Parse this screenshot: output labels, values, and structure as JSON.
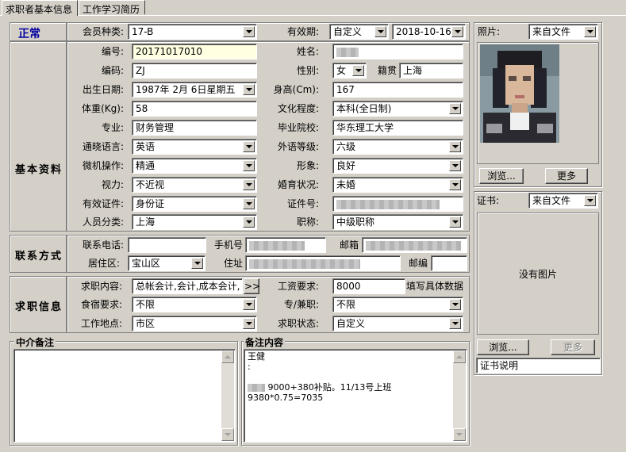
{
  "tabs": [
    {
      "label": "求职者基本信息"
    },
    {
      "label": "工作学习简历"
    }
  ],
  "status": {
    "text": "正常",
    "color": "#0000a0"
  },
  "top": {
    "member_type_label": "会员种类:",
    "member_type": "17-B",
    "validity_label": "有效期:",
    "validity_type": "自定义",
    "validity_date": "2018-10-16"
  },
  "basic": {
    "group_label": "基本资料",
    "number_label": "编号:",
    "number": "20171017010",
    "name_label": "姓名:",
    "code_label": "编码:",
    "code": "ZJ",
    "gender_label": "性别:",
    "gender": "女",
    "native_label": "籍贯",
    "native": "上海",
    "birth_label": "出生日期:",
    "birth": "1987年 2月 6日星期五",
    "height_label": "身高(Cm):",
    "height": "167",
    "weight_label": "体重(Kg):",
    "weight": "58",
    "edu_label": "文化程度:",
    "edu": "本科(全日制)",
    "major_label": "专业:",
    "major": "财务管理",
    "school_label": "毕业院校:",
    "school": "华东理工大学",
    "lang_label": "通晓语言:",
    "lang": "英语",
    "lang_level_label": "外语等级:",
    "lang_level": "六级",
    "pc_label": "微机操作:",
    "pc": "精通",
    "image_label": "形象:",
    "image": "良好",
    "vision_label": "视力:",
    "vision": "不近视",
    "marital_label": "婚育状况:",
    "marital": "未婚",
    "id_type_label": "有效证件:",
    "id_type": "身份证",
    "id_no_label": "证件号:",
    "category_label": "人员分类:",
    "category": "上海",
    "title_label": "职称:",
    "title": "中级职称"
  },
  "contact": {
    "group_label": "联系方式",
    "phone_label": "联系电话:",
    "mobile_label": "手机号",
    "email_label": "邮箱",
    "district_label": "居住区:",
    "district": "宝山区",
    "address_label": "住址",
    "postcode_label": "邮编"
  },
  "job": {
    "group_label": "求职信息",
    "position_label": "求职内容:",
    "position": "总帐会计,会计,成本会计,",
    "more_btn": ">>",
    "salary_label": "工资要求:",
    "salary": "8000",
    "salary_hint": "填写具体数据",
    "board_label": "食宿要求:",
    "board": "不限",
    "fulltime_label": "专/兼职:",
    "fulltime": "不限",
    "location_label": "工作地点:",
    "location": "市区",
    "status_label": "求职状态:",
    "status": "自定义"
  },
  "notes": {
    "agency_label": "中介备注",
    "content_label": "备注内容",
    "line1": "王健",
    "line2": ":",
    "line3": "9000+380补贴。11/13号上班",
    "line4": "9380*0.75=7035"
  },
  "photo": {
    "label": "照片:",
    "source": "来自文件",
    "browse": "浏览...",
    "more": "更多"
  },
  "cert": {
    "label": "证书:",
    "source": "来自文件",
    "empty": "没有图片",
    "browse": "浏览...",
    "more": "更多",
    "desc": "证书说明"
  }
}
